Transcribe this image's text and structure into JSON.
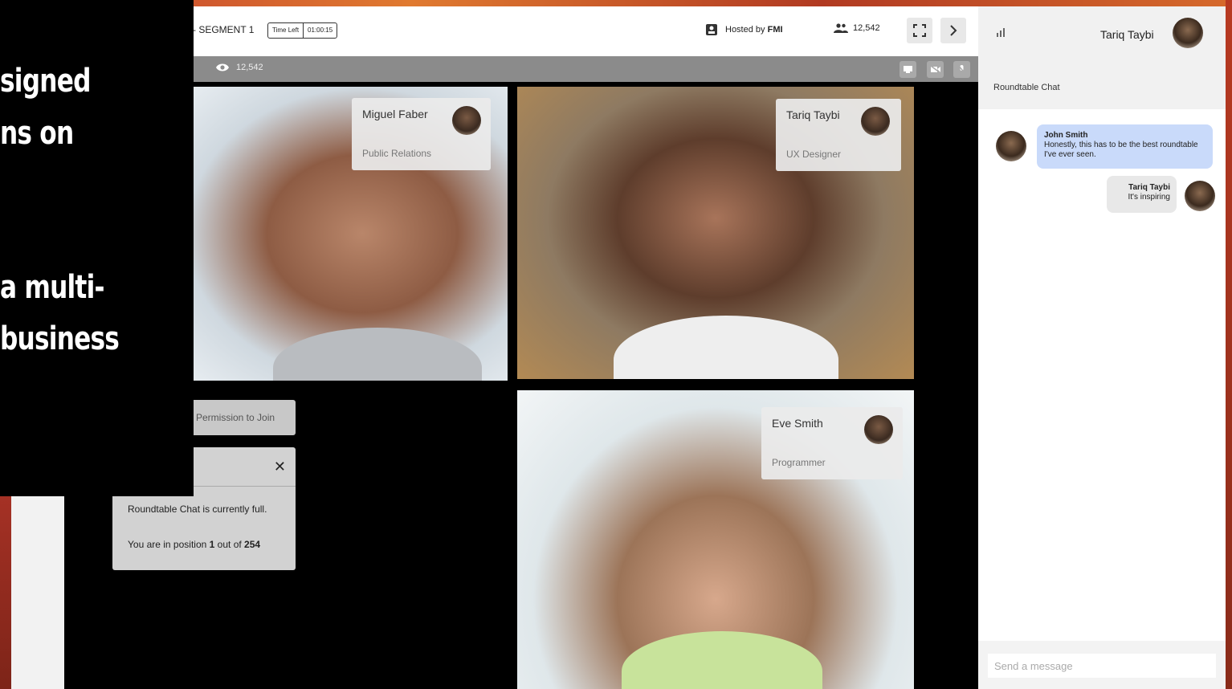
{
  "overlay": {
    "lines": [
      "signed",
      "ns on",
      "a multi-",
      "business"
    ]
  },
  "topbar": {
    "segment": "- SEGMENT 1",
    "time_left_label": "Time Left",
    "time_left_value": "01:00:15",
    "hosted_by_prefix": "Hosted by",
    "host": "FMI",
    "viewer_count": "12,542"
  },
  "greybar": {
    "watch_count": "12,542"
  },
  "participants": [
    {
      "name": "Miguel Faber",
      "role": "Public Relations"
    },
    {
      "name": "Tariq Taybi",
      "role": "UX Designer"
    },
    {
      "name": "Eve Smith",
      "role": "Programmer"
    }
  ],
  "permission_button": "Permission to Join",
  "queue": {
    "message": "Roundtable Chat is currently full.",
    "position_prefix": "You are in position",
    "position": "1",
    "position_mid": "out of",
    "total": "254",
    "close": "✕"
  },
  "chat": {
    "user": "Tariq Taybi",
    "title": "Roundtable Chat",
    "messages": [
      {
        "sender": "John Smith",
        "text": "Honestly, this has to be the best roundtable I've ever seen."
      },
      {
        "sender": "Tariq Taybi",
        "text": "It's inspiring"
      }
    ],
    "input_placeholder": "Send a message"
  },
  "colors": {
    "accent_bubble": "#c9dafa",
    "background_brand": "#b13a22"
  }
}
